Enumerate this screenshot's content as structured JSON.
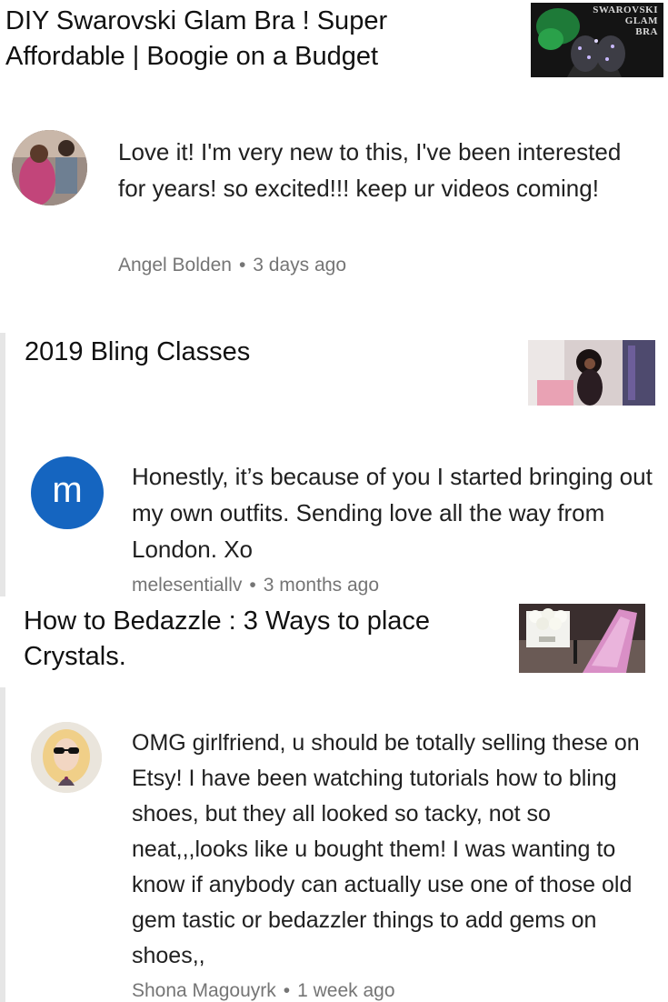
{
  "items": [
    {
      "video_title": "DIY Swarovski Glam Bra ! Super Affordable | Boogie on a Budget",
      "thumbnail_text": [
        "SWAROVSKI",
        "GLAM",
        "BRA"
      ],
      "comment_text": "Love it!  I'm very new to this, I've been interested for  years!  so excited!!! keep ur videos coming!",
      "author": "Angel Bolden",
      "time": "3 days ago"
    },
    {
      "video_title": "2019 Bling Classes",
      "avatar_letter": "m",
      "comment_text": "Honestly, it’s because of you I started bringing out my own outfits. Sending love all the way from London. Xo",
      "author": "melesentiallv",
      "time": "3 months ago"
    },
    {
      "video_title": "How to Bedazzle : 3 Ways to place Crystals.",
      "comment_text": "OMG girlfriend, u should be totally selling these on Etsy! I have been watching tutorials how to bling shoes, but they all looked so tacky, not so neat,,,looks like u bought them! I was wanting to know if anybody can actually use one of those old gem tastic or bedazzler things to add gems on shoes,,",
      "author": "Shona Magouyrk",
      "time": "1 week ago"
    }
  ],
  "meta_separator": "•",
  "colors": {
    "avatar_m": "#1565c0",
    "meta": "#757575"
  }
}
